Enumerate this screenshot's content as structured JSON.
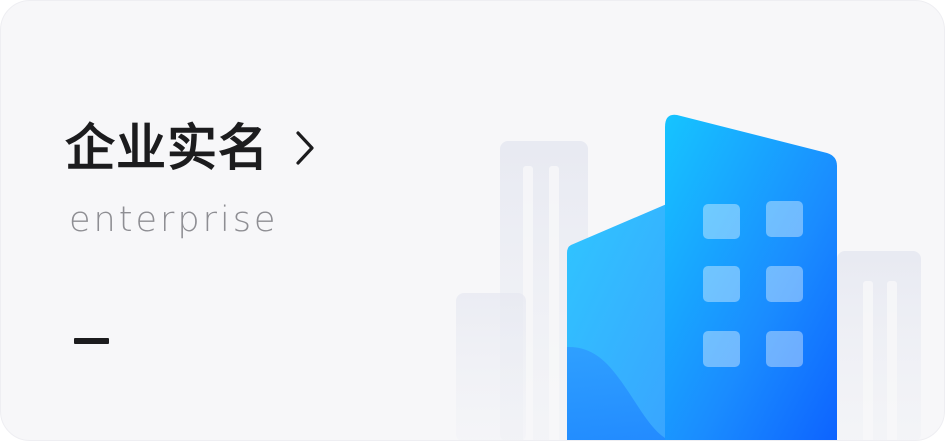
{
  "card": {
    "title": "企业实名",
    "subtitle": "enterprise"
  },
  "icons": {
    "chevron": "chevron-right-icon",
    "illustration": "office-building-icon"
  },
  "colors": {
    "background": "#f7f7f9",
    "title": "#1c1c1e",
    "subtitle": "#8e8e93",
    "accent_blue": "#1a8cff",
    "accent_cyan": "#2bb8ff"
  }
}
